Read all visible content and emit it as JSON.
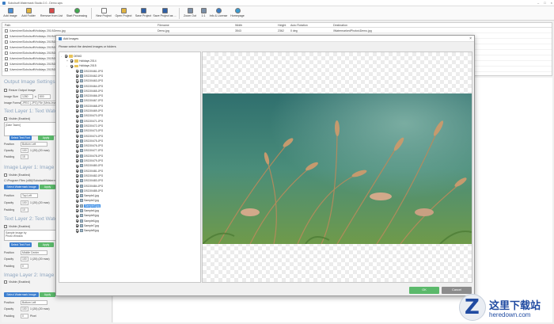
{
  "window": {
    "title": "Sobolsoft Watermark Studio 2.0 - Demo.wps"
  },
  "toolbar": {
    "buttons": [
      {
        "label": "Add Image",
        "icon": "add-image-icon",
        "color": "#4a8fd6"
      },
      {
        "label": "Add Folder",
        "icon": "add-folder-icon",
        "color": "#e0b341"
      },
      {
        "label": "Remove from List",
        "icon": "remove-icon",
        "color": "#d64a4a"
      },
      {
        "label": "Start Processing",
        "icon": "play-icon",
        "color": "#3faa4e"
      },
      {
        "label": "New Project",
        "icon": "new-file-icon",
        "color": "#ffffff"
      },
      {
        "label": "Open Project",
        "icon": "open-folder-icon",
        "color": "#e0b341"
      },
      {
        "label": "Save Project",
        "icon": "save-icon",
        "color": "#2f5fa5"
      },
      {
        "label": "Save Project as ...",
        "icon": "save-as-icon",
        "color": "#2f5fa5"
      },
      {
        "label": "Zoom Out",
        "icon": "zoom-out-icon",
        "color": "#7a8ea6"
      },
      {
        "label": "1:1",
        "icon": "actual-size-icon",
        "color": "#7a8ea6"
      },
      {
        "label": "Info & License",
        "icon": "info-icon",
        "color": "#3b7dc4"
      },
      {
        "label": "Homepage",
        "icon": "globe-icon",
        "color": "#3a9bd1"
      }
    ]
  },
  "filelist": {
    "columns": [
      "Path",
      "Filename",
      "Width",
      "Height",
      "Auto Rotation",
      "Destination"
    ],
    "rows": [
      {
        "path": "\\Users\\me\\Sobolsoft\\Holidays 2014\\Demo.jpg",
        "filename": "Demo.jpg",
        "width": "3543",
        "height": "2362",
        "rotation": "0 deg",
        "destination": "\\WatermarkedPhotos\\Demo.jpg"
      },
      {
        "path": "\\Users\\me\\Sobolsoft\\Holidays 2015\\DSC00461.JPG",
        "filename": "",
        "width": "",
        "height": "",
        "rotation": "",
        "destination": ""
      },
      {
        "path": "\\Users\\me\\Sobolsoft\\Holidays 2015\\DSC00462.JPG",
        "filename": "",
        "width": "",
        "height": "",
        "rotation": "",
        "destination": ""
      },
      {
        "path": "\\Users\\me\\Sobolsoft\\Holidays 2015\\DSC00463.JPG",
        "filename": "",
        "width": "",
        "height": "",
        "rotation": "",
        "destination": ""
      },
      {
        "path": "\\Users\\me\\Sobolsoft\\Holidays 2015\\DSC00464.JPG",
        "filename": "",
        "width": "",
        "height": "",
        "rotation": "",
        "destination": ""
      },
      {
        "path": "\\Users\\me\\Sobolsoft\\Holidays 2015\\DSC00465.JPG",
        "filename": "",
        "width": "",
        "height": "",
        "rotation": "",
        "destination": ""
      },
      {
        "path": "\\Users\\me\\Sobolsoft\\Holidays 2015\\DSC00466.JPG",
        "filename": "",
        "width": "",
        "height": "",
        "rotation": "",
        "destination": ""
      },
      {
        "path": "\\Users\\me\\Sobolsoft\\Holidays 2015\\DSC00467.JPG",
        "filename": "",
        "width": "",
        "height": "",
        "rotation": "",
        "destination": ""
      }
    ]
  },
  "settings": {
    "output_title": "Output Image Settings",
    "resize_label": "Resize Output Image",
    "image_size_label": "Image Size",
    "width_value": "1280",
    "height_value": "800",
    "format_label": "Image Format",
    "format_value": "JPEG (.JPG) File (Meta-Image Changes)",
    "text1_title": "Text Layer 1: Text Watermark",
    "visible_label": "Visible (Enabled)",
    "text1_value": "[Date Taken]",
    "select_font_label": "Select Text Font",
    "apply_label": "Apply",
    "position_label": "Position",
    "text1_position": "Bottom Left",
    "opacity_label": "Opacity",
    "text1_opacity": "100",
    "text1_size": "1 (20) (20 max)",
    "padding_label": "Padding",
    "text1_padding": "15",
    "image1_title": "Image Layer 1: Image Watermark",
    "image1_program": "C:\\Program Files (x86)\\Sobolsoft\\Watermark Studio\\",
    "select_image_label": "Select Watermark Image",
    "image1_position": "Top Left",
    "image1_opacity": "100",
    "image1_size": "1 (20) (20 max)",
    "image1_padding": "10",
    "text2_title": "Text Layer 2: Text Watermark",
    "text2_value": "Sample Image by\nPhoto Window",
    "text2_position": "Middle Center",
    "text2_opacity": "100",
    "text2_size": "1 (20) (20 max)",
    "text2_padding": "0",
    "image2_title": "Image Layer 2: Image Watermark",
    "image2_position": "Bottom Left",
    "image2_opacity": "100",
    "image2_size": "1 (20) (20 max)",
    "image2_padding": "0",
    "pixel_label": "Pixel"
  },
  "dialog": {
    "title": "Add Images",
    "instruction": "Please select the desired images or folders",
    "tree": [
      {
        "level": 0,
        "type": "folder",
        "label": "DEMO",
        "expand": "-",
        "checked": true
      },
      {
        "level": 1,
        "type": "folder",
        "label": "Holidays 2014",
        "expand": "+",
        "checked": true
      },
      {
        "level": 1,
        "type": "folder",
        "label": "Holidays 2015",
        "expand": "-",
        "checked": true
      },
      {
        "level": 2,
        "type": "image",
        "label": "DSC00461.JPG",
        "checked": true
      },
      {
        "level": 2,
        "type": "image",
        "label": "DSC00462.JPG",
        "checked": true
      },
      {
        "level": 2,
        "type": "image",
        "label": "DSC00463.JPG",
        "checked": true
      },
      {
        "level": 2,
        "type": "image",
        "label": "DSC00464.JPG",
        "checked": true
      },
      {
        "level": 2,
        "type": "image",
        "label": "DSC00465.JPG",
        "checked": true
      },
      {
        "level": 2,
        "type": "image",
        "label": "DSC00466.JPG",
        "checked": true
      },
      {
        "level": 2,
        "type": "image",
        "label": "DSC00467.JPG",
        "checked": true
      },
      {
        "level": 2,
        "type": "image",
        "label": "DSC00468.JPG",
        "checked": true
      },
      {
        "level": 2,
        "type": "image",
        "label": "DSC00469.JPG",
        "checked": true
      },
      {
        "level": 2,
        "type": "image",
        "label": "DSC00470.JPG",
        "checked": true
      },
      {
        "level": 2,
        "type": "image",
        "label": "DSC00471.JPG",
        "checked": true
      },
      {
        "level": 2,
        "type": "image",
        "label": "DSC00472.JPG",
        "checked": true
      },
      {
        "level": 2,
        "type": "image",
        "label": "DSC00473.JPG",
        "checked": true
      },
      {
        "level": 2,
        "type": "image",
        "label": "DSC00474.JPG",
        "checked": true
      },
      {
        "level": 2,
        "type": "image",
        "label": "DSC00475.JPG",
        "checked": true
      },
      {
        "level": 2,
        "type": "image",
        "label": "DSC00476.JPG",
        "checked": true
      },
      {
        "level": 2,
        "type": "image",
        "label": "DSC00477.JPG",
        "checked": true
      },
      {
        "level": 2,
        "type": "image",
        "label": "DSC00478.JPG",
        "checked": true
      },
      {
        "level": 2,
        "type": "image",
        "label": "DSC00479.JPG",
        "checked": true
      },
      {
        "level": 2,
        "type": "image",
        "label": "DSC00480.JPG",
        "checked": true
      },
      {
        "level": 2,
        "type": "image",
        "label": "DSC00481.JPG",
        "checked": true
      },
      {
        "level": 2,
        "type": "image",
        "label": "DSC00482.JPG",
        "checked": true
      },
      {
        "level": 2,
        "type": "image",
        "label": "DSC00483.JPG",
        "checked": true
      },
      {
        "level": 2,
        "type": "image",
        "label": "DSC00484.JPG",
        "checked": true
      },
      {
        "level": 2,
        "type": "image",
        "label": "DSC00485.JPG",
        "checked": true
      },
      {
        "level": 2,
        "type": "image",
        "label": "Sample1.jpg",
        "checked": true
      },
      {
        "level": 2,
        "type": "image",
        "label": "Sample2.jpg",
        "checked": true
      },
      {
        "level": 2,
        "type": "image",
        "label": "Sample3.jpg",
        "checked": true,
        "selected": true
      },
      {
        "level": 2,
        "type": "image",
        "label": "Sample4.jpg",
        "checked": true
      },
      {
        "level": 2,
        "type": "image",
        "label": "Sample5.jpg",
        "checked": true
      },
      {
        "level": 2,
        "type": "image",
        "label": "Sample6.jpg",
        "checked": true
      },
      {
        "level": 2,
        "type": "image",
        "label": "Sample7.jpg",
        "checked": true
      },
      {
        "level": 2,
        "type": "image",
        "label": "Sample8.jpg",
        "checked": true
      }
    ],
    "ok_label": "OK",
    "cancel_label": "Cancel"
  },
  "watermark": {
    "chinese_text": "这里下载站",
    "domain": "heredown.com"
  }
}
